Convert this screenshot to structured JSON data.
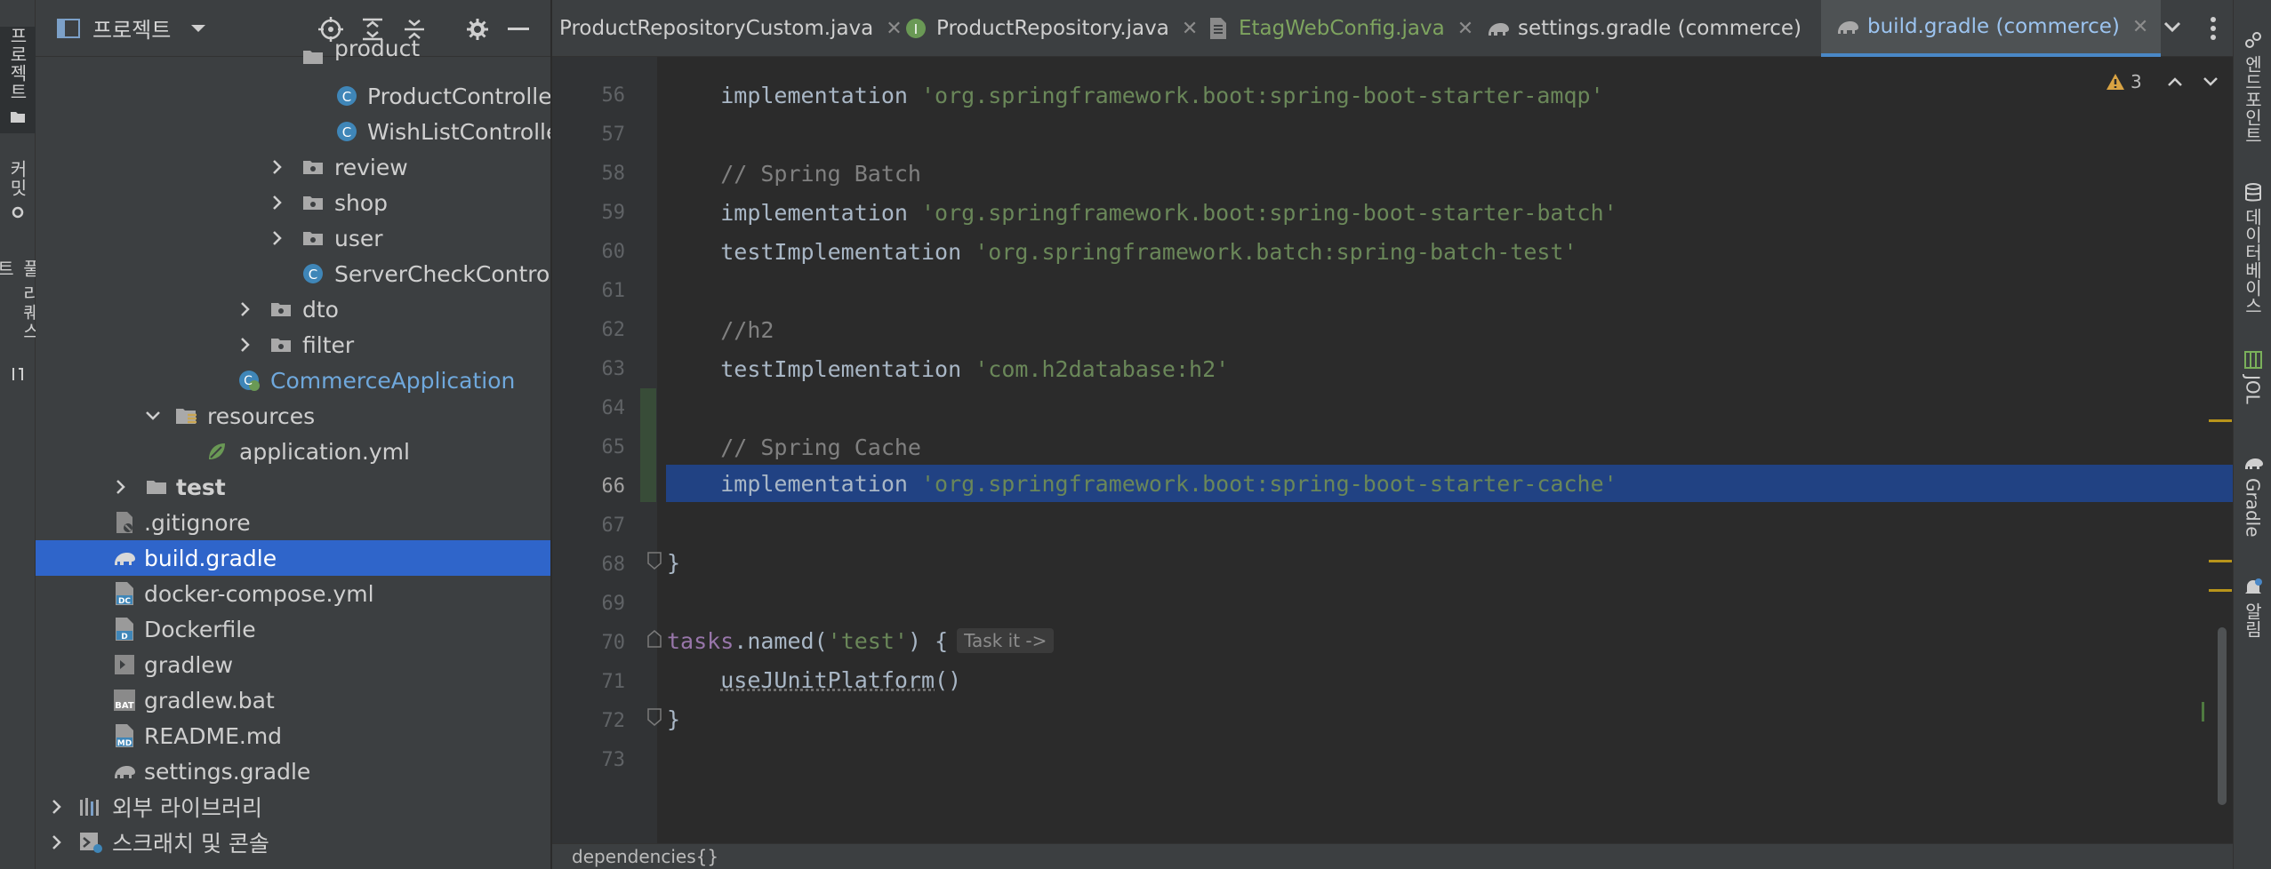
{
  "left_strip": {
    "project_label": "프로젝트",
    "commit_label": "커밋",
    "pull_requests_label": "풀 리퀘스트"
  },
  "project_panel": {
    "title": "프로젝트",
    "tree": [
      {
        "label": "product",
        "kind": "folder"
      },
      {
        "label": "ProductController",
        "kind": "class"
      },
      {
        "label": "WishListController",
        "kind": "class"
      },
      {
        "label": "review",
        "kind": "folder"
      },
      {
        "label": "shop",
        "kind": "folder"
      },
      {
        "label": "user",
        "kind": "folder"
      },
      {
        "label": "ServerCheckController",
        "kind": "class"
      },
      {
        "label": "dto",
        "kind": "folder"
      },
      {
        "label": "filter",
        "kind": "folder"
      },
      {
        "label": "CommerceApplication",
        "kind": "spring-class"
      },
      {
        "label": "resources",
        "kind": "resources-folder"
      },
      {
        "label": "application.yml",
        "kind": "yml"
      },
      {
        "label": "test",
        "kind": "folder"
      },
      {
        "label": ".gitignore",
        "kind": "file"
      },
      {
        "label": "build.gradle",
        "kind": "gradle"
      },
      {
        "label": "docker-compose.yml",
        "kind": "docker-compose"
      },
      {
        "label": "Dockerfile",
        "kind": "dockerfile"
      },
      {
        "label": "gradlew",
        "kind": "shell"
      },
      {
        "label": "gradlew.bat",
        "kind": "bat"
      },
      {
        "label": "README.md",
        "kind": "markdown"
      },
      {
        "label": "settings.gradle",
        "kind": "gradle"
      },
      {
        "label": "외부 라이브러리",
        "kind": "libraries"
      },
      {
        "label": "스크래치 및 콘솔",
        "kind": "scratches"
      }
    ]
  },
  "tabs": [
    {
      "label": "ProductRepositoryCustom.java",
      "icon": "interface-icon",
      "active": false
    },
    {
      "label": "ProductRepository.java",
      "icon": "interface-icon",
      "active": false
    },
    {
      "label": "EtagWebConfig.java",
      "icon": "java-file-icon",
      "active": false
    },
    {
      "label": "settings.gradle (commerce)",
      "icon": "gradle-icon",
      "active": false
    },
    {
      "label": "build.gradle (commerce)",
      "icon": "gradle-icon",
      "active": true
    }
  ],
  "editor": {
    "line_numbers": [
      "56",
      "57",
      "58",
      "59",
      "60",
      "61",
      "62",
      "63",
      "64",
      "65",
      "66",
      "67",
      "68",
      "69",
      "70",
      "71",
      "72",
      "73"
    ],
    "current_line": "66",
    "lines": {
      "l56_kw": "implementation",
      "l56_str": "'org.springframework.boot:spring-boot-starter-amqp'",
      "l58_cmt": "// Spring Batch",
      "l59_kw": "implementation",
      "l59_str": "'org.springframework.boot:spring-boot-starter-batch'",
      "l60_kw": "testImplementation",
      "l60_str": "'org.springframework.batch:spring-batch-test'",
      "l62_cmt": "//h2",
      "l63_kw": "testImplementation",
      "l63_str": "'com.h2database:h2'",
      "l65_cmt": "// Spring Cache",
      "l66_kw": "implementation",
      "l66_str": "'org.springframework.boot:spring-boot-starter-cache'",
      "l68_brace": "}",
      "l70_tasks": "tasks",
      "l70_dot": ".",
      "l70_named": "named",
      "l70_paren_open": "(",
      "l70_str": "'test'",
      "l70_rest": ") {",
      "l70_hint": "Task it ->",
      "l71_fn": "useJUnitPlatform",
      "l71_rest": "()",
      "l72_brace": "}"
    },
    "breadcrumb": "dependencies{}",
    "warnings_count": "3"
  },
  "right_strip": {
    "endpoints_label": "엔드포인트",
    "database_label": "데이터베이스",
    "jol_label": "JOL",
    "gradle_label": "Gradle",
    "notifications_label": "알림"
  },
  "colors": {
    "selection": "#214283",
    "tree_selected": "#2f65ca",
    "string": "#6a8759",
    "keyword": "#cc7832",
    "comment": "#808080",
    "active_tab_text": "#9cc4f0"
  }
}
